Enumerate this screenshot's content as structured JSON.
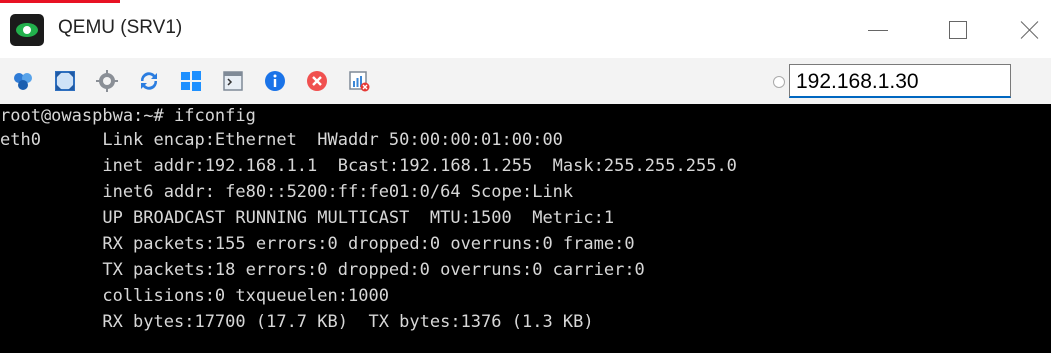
{
  "window": {
    "title": "QEMU (SRV1)"
  },
  "toolbar": {
    "tools": [
      {
        "name": "vms-icon"
      },
      {
        "name": "fullscreen-icon"
      },
      {
        "name": "settings-gear-icon"
      },
      {
        "name": "refresh-icon"
      },
      {
        "name": "windows-icon"
      },
      {
        "name": "console-icon"
      },
      {
        "name": "info-icon"
      },
      {
        "name": "stop-icon"
      },
      {
        "name": "stats-icon"
      }
    ],
    "ip_address": "192.168.1.30"
  },
  "terminal": {
    "lines": [
      "root@owaspbwa:~# ifconfig",
      "eth0      Link encap:Ethernet  HWaddr 50:00:00:01:00:00",
      "          inet addr:192.168.1.1  Bcast:192.168.1.255  Mask:255.255.255.0",
      "          inet6 addr: fe80::5200:ff:fe01:0/64 Scope:Link",
      "          UP BROADCAST RUNNING MULTICAST  MTU:1500  Metric:1",
      "          RX packets:155 errors:0 dropped:0 overruns:0 frame:0",
      "          TX packets:18 errors:0 dropped:0 overruns:0 carrier:0",
      "          collisions:0 txqueuelen:1000",
      "          RX bytes:17700 (17.7 KB)  TX bytes:1376 (1.3 KB)"
    ]
  },
  "colors": {
    "accent": "#0067c0",
    "terminal_bg": "#000000",
    "terminal_fg": "#d7d7d7"
  }
}
